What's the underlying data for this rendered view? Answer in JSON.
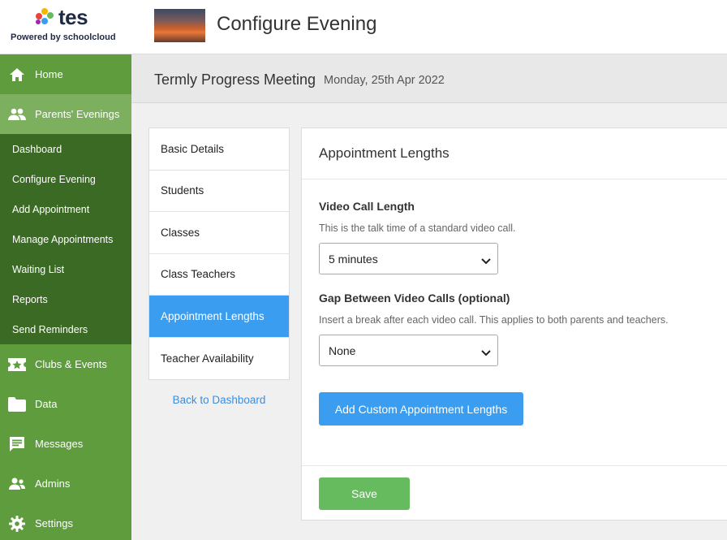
{
  "brand": {
    "logo_text": "tes",
    "powered_prefix": "Powered by ",
    "powered_brand": "schoolcloud"
  },
  "header": {
    "title": "Configure Evening"
  },
  "sidebar": {
    "main_items": [
      {
        "label": "Home",
        "icon": "home-icon"
      },
      {
        "label": "Parents' Evenings",
        "icon": "people-icon"
      }
    ],
    "sub_items": [
      {
        "label": "Dashboard"
      },
      {
        "label": "Configure Evening"
      },
      {
        "label": "Add Appointment"
      },
      {
        "label": "Manage Appointments"
      },
      {
        "label": "Waiting List"
      },
      {
        "label": "Reports"
      },
      {
        "label": "Send Reminders"
      }
    ],
    "lower_items": [
      {
        "label": "Clubs & Events",
        "icon": "star-ticket-icon"
      },
      {
        "label": "Data",
        "icon": "folder-icon"
      },
      {
        "label": "Messages",
        "icon": "message-icon"
      },
      {
        "label": "Admins",
        "icon": "admins-icon"
      },
      {
        "label": "Settings",
        "icon": "gear-icon"
      }
    ]
  },
  "meeting": {
    "name": "Termly Progress Meeting",
    "date": "Monday, 25th Apr 2022"
  },
  "config_menu": {
    "items": [
      {
        "label": "Basic Details"
      },
      {
        "label": "Students"
      },
      {
        "label": "Classes"
      },
      {
        "label": "Class Teachers"
      },
      {
        "label": "Appointment Lengths",
        "active": true
      },
      {
        "label": "Teacher Availability"
      }
    ],
    "back_link": "Back to Dashboard"
  },
  "panel": {
    "title": "Appointment Lengths",
    "video_length": {
      "label": "Video Call Length",
      "help": "This is the talk time of a standard video call.",
      "value": "5 minutes"
    },
    "gap": {
      "label": "Gap Between Video Calls (optional)",
      "help": "Insert a break after each video call. This applies to both parents and teachers.",
      "value": "None"
    },
    "custom_button": "Add Custom Appointment Lengths",
    "save_button": "Save"
  },
  "colors": {
    "sidebar_green": "#5e9c3e",
    "sidebar_active": "#7db05e",
    "subnav_dark": "#3b6a24",
    "accent_blue": "#3a9df0",
    "save_green": "#66bb5e"
  }
}
